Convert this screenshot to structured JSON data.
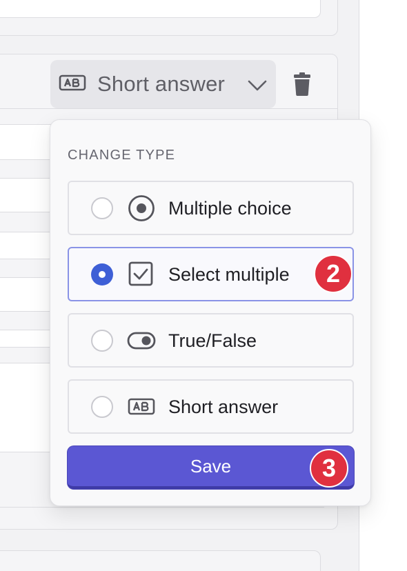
{
  "question": {
    "type_select_label": "Short answer"
  },
  "popover": {
    "header": "CHANGE TYPE",
    "options": [
      {
        "label": "Multiple choice",
        "icon": "radio-choice-icon",
        "selected": false
      },
      {
        "label": "Select multiple",
        "icon": "checkbox-icon",
        "selected": true
      },
      {
        "label": "True/False",
        "icon": "toggle-icon",
        "selected": false
      },
      {
        "label": "Short answer",
        "icon": "ab-text-icon",
        "selected": false
      }
    ],
    "save_label": "Save"
  },
  "badges": {
    "select_multiple": "2",
    "save": "3"
  },
  "colors": {
    "accent": "#5b57d3",
    "radio_selected": "#3e5fd6",
    "badge": "#e0303f",
    "selected_border": "#8a93e6"
  }
}
